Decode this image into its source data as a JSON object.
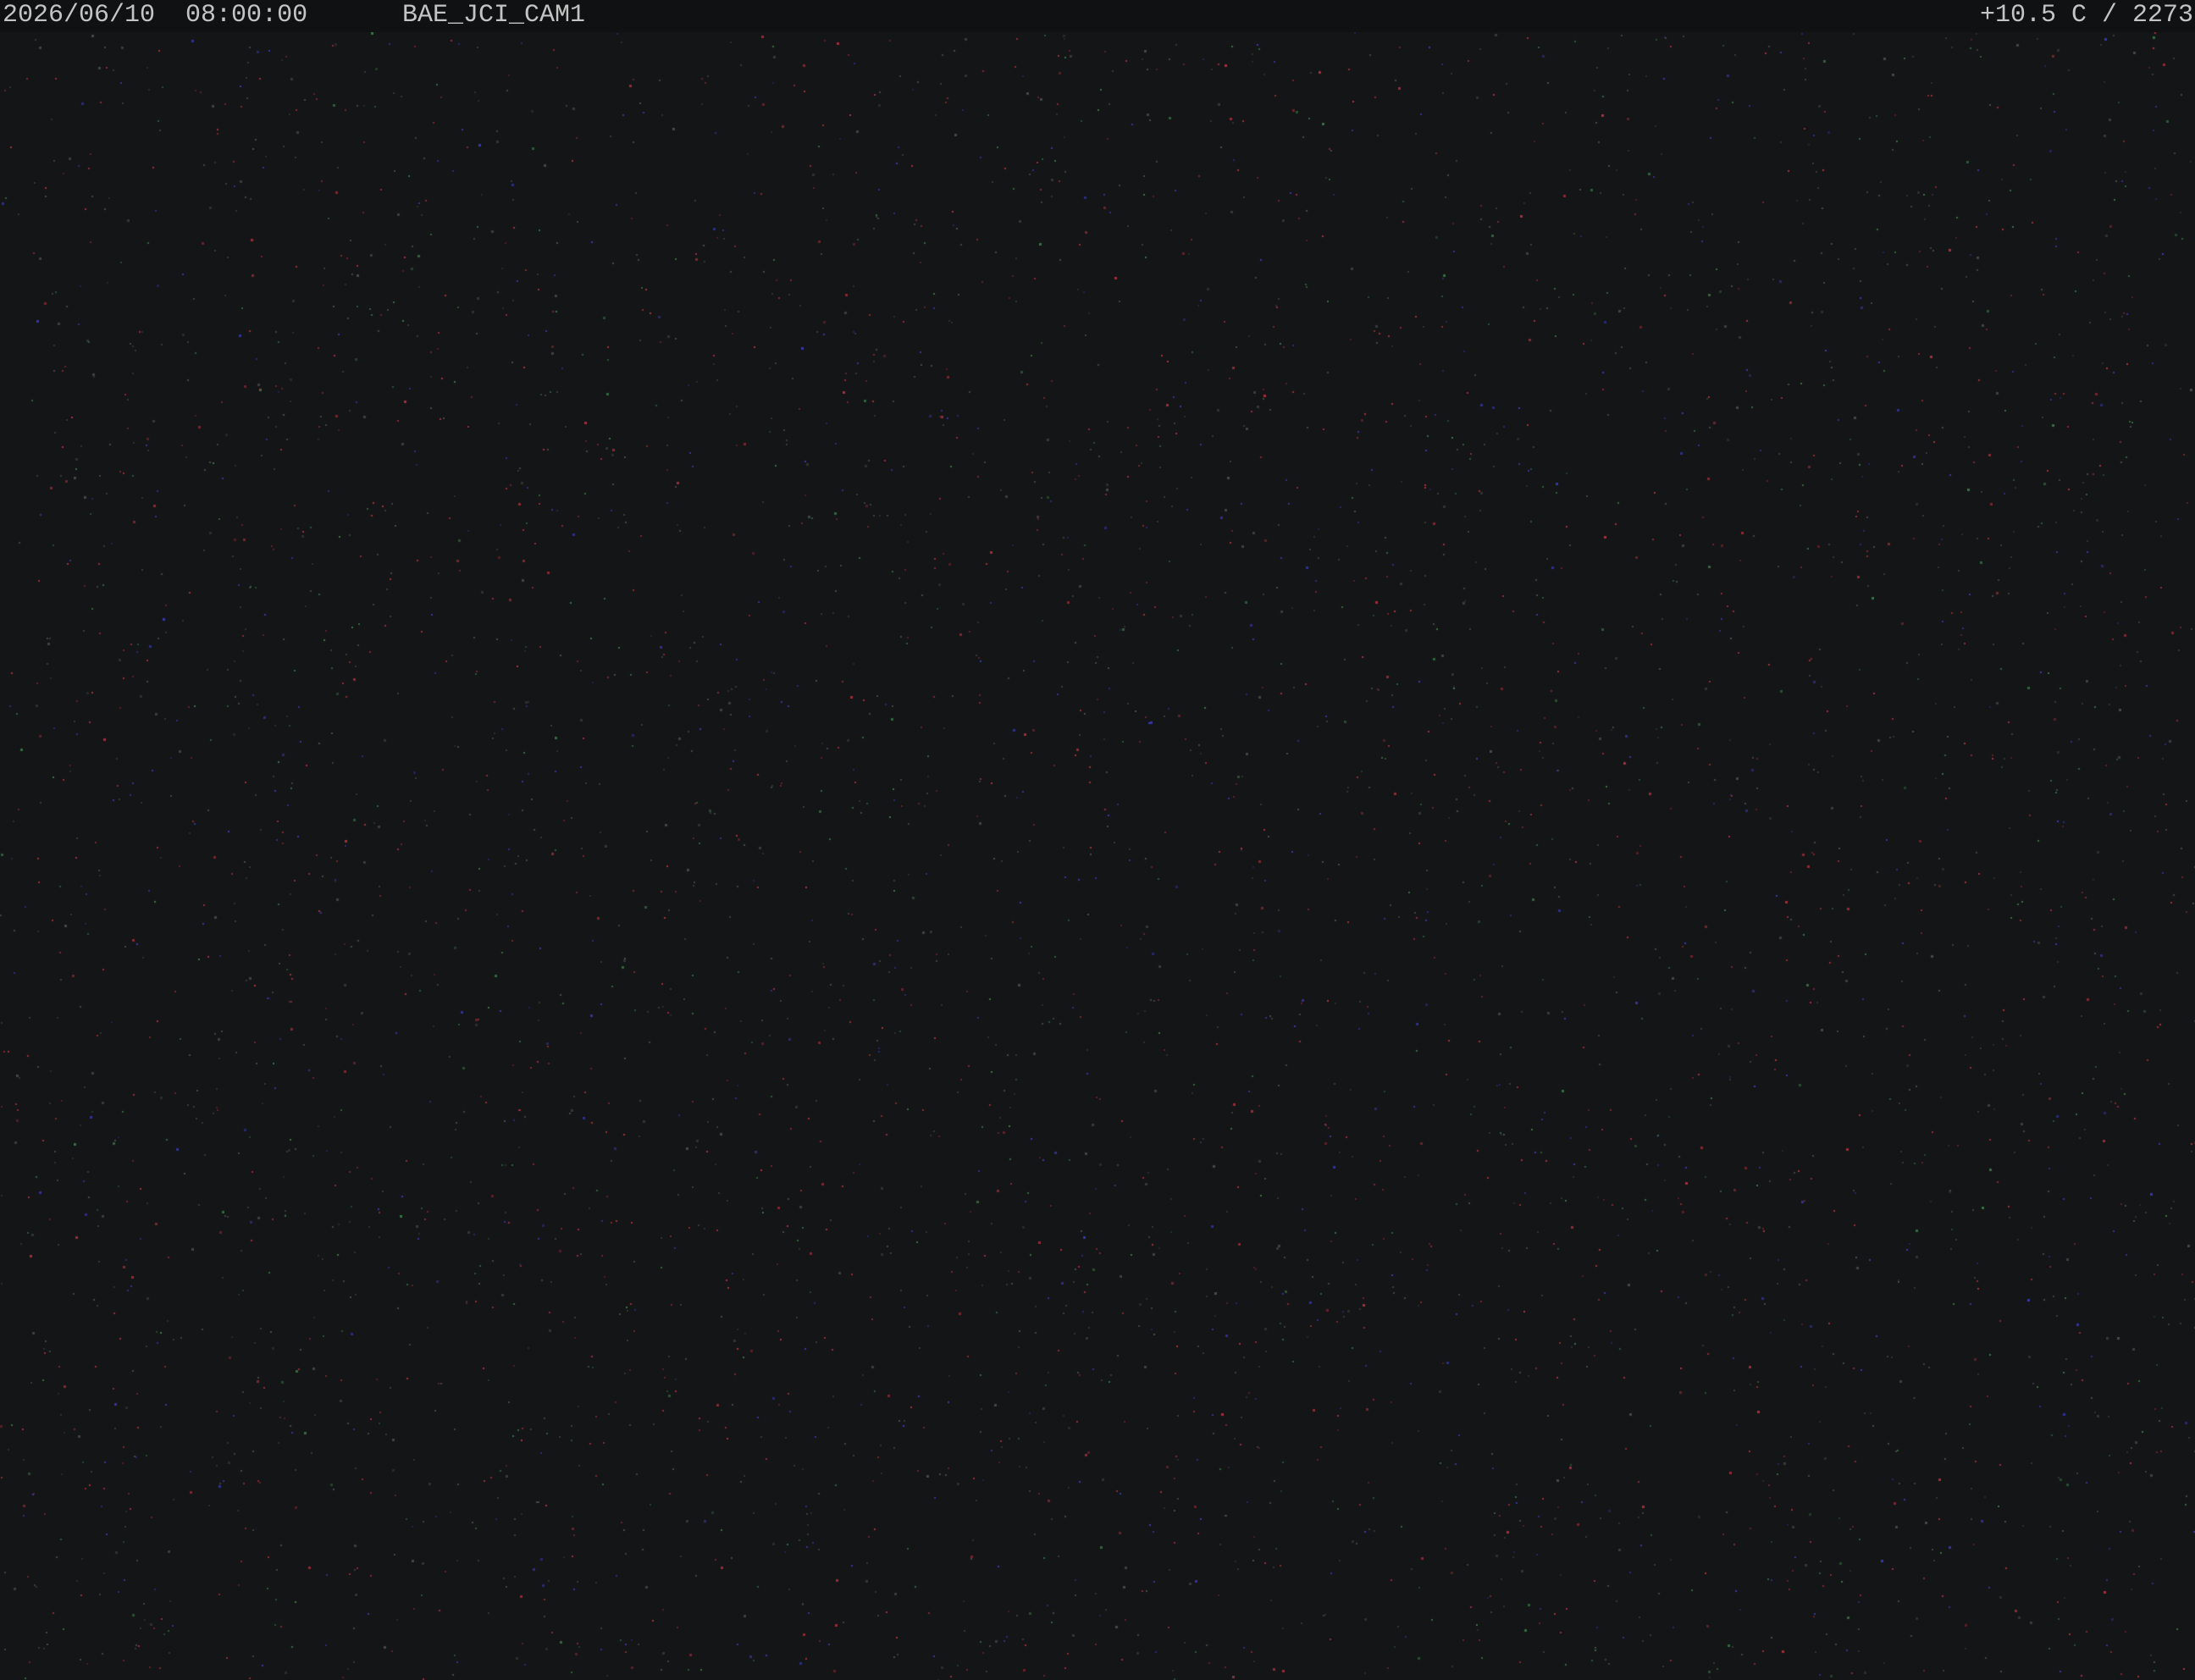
{
  "overlay": {
    "date": "2026/06/10",
    "time": "08:00:00",
    "camera_id": "BAE_JCI_CAM1",
    "sensor_readout": "+10.5 C / 2273"
  },
  "colors": {
    "background": "#141516",
    "overlay_bar": "#101112",
    "overlay_text": "#c4c4c4",
    "noise_red": "#b03040",
    "noise_blue": "#3a3ab8",
    "noise_green": "#3a7a4a",
    "noise_gray": "#4a4c4e"
  }
}
